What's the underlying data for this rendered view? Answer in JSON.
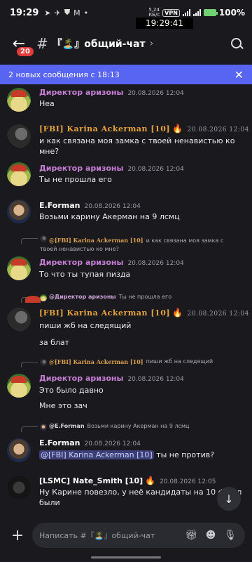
{
  "status_bar": {
    "time": "19:29",
    "net_speed": "5,24\nКБ/с",
    "vpn": "VPN",
    "battery": "100%",
    "overlay_time": "19:29:41"
  },
  "header": {
    "unread_badge": "20",
    "channel_name": "『🏝️』общий-чат"
  },
  "new_messages_bar": {
    "text": "2 новых сообщения с 18:13"
  },
  "messages": [
    {
      "author": "Директор аризоны",
      "timestamp": "20.08.2026 12:04",
      "lines": [
        "Неа"
      ]
    },
    {
      "author": "[FBI] Karina Ackerman [10]",
      "timestamp": "20.08.2026 12:04",
      "lines": [
        "и как связана моя замка с твоей ненавистью ко мне?"
      ]
    },
    {
      "author": "Директор аризоны",
      "timestamp": "20.08.2026 12:04",
      "lines": [
        "Ты не прошла его"
      ]
    },
    {
      "author": "E.Forman",
      "timestamp": "20.08.2026 12:04",
      "lines": [
        "Возьми карину Акерман на 9 лсмц"
      ]
    },
    {
      "reply": {
        "author": "@[FBI] Karina Ackerman [10]",
        "text": "и как связана моя замка с твоей ненавистью ко мне?"
      },
      "author": "Директор аризоны",
      "timestamp": "20.08.2026 12:04",
      "lines": [
        "То что ты тупая пизда"
      ]
    },
    {
      "reply": {
        "author": "@Директор аризоны",
        "text": "Ты не прошла его"
      },
      "author": "[FBI] Karina Ackerman [10]",
      "timestamp": "20.08.2026 12:04",
      "lines": [
        "пиши жб на следящий",
        "за блат"
      ]
    },
    {
      "reply": {
        "author": "@[FBI] Karina Ackerman [10]",
        "text": "пиши жб на следящий"
      },
      "author": "Директор аризоны",
      "timestamp": "20.08.2026 12:04",
      "lines": [
        "Это было давно",
        "Мне это зач"
      ]
    },
    {
      "reply": {
        "author": "@E.Forman",
        "text": "Возьми карину Акерман на 9 лсмц"
      },
      "author": "E.Forman",
      "timestamp": "20.08.2026 12:04",
      "mention": "@[FBI] Karina Ackerman [10]",
      "lines": [
        " ты не против?"
      ]
    },
    {
      "author": "[LSMC] Nate_Smith [10]",
      "timestamp": "20.08.2026 12:05",
      "lines": [
        "Ну Карине повезло, у неё кандидаты на 10 фбр л",
        "были"
      ]
    }
  ],
  "composer": {
    "placeholder": "Написать #『🏝️』общий-чат"
  }
}
